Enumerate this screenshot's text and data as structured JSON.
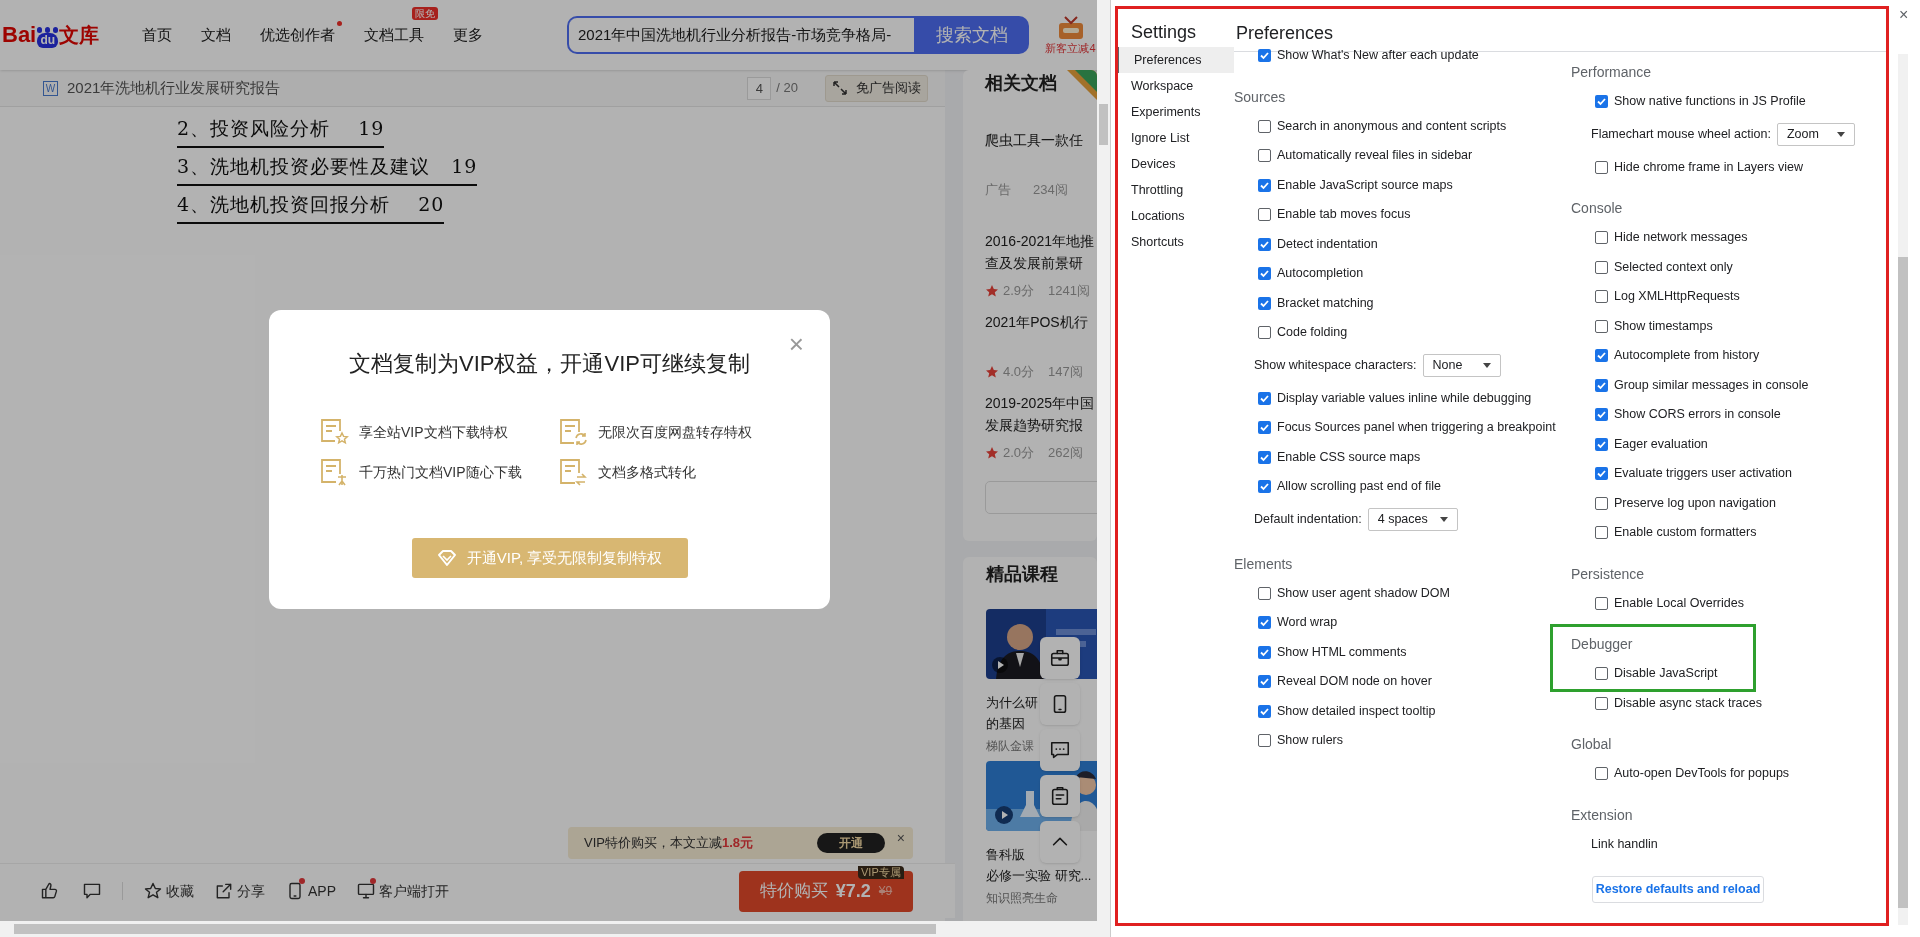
{
  "browser_page": {
    "header": {
      "logo": {
        "left": "Bai",
        "paw": "du",
        "right": "文库"
      },
      "nav": [
        {
          "label": "首页",
          "dot": false
        },
        {
          "label": "文档",
          "dot": false
        },
        {
          "label": "优选创作者",
          "dot": true
        },
        {
          "label": "文档工具",
          "dot": false,
          "badge": "限免"
        },
        {
          "label": "更多",
          "dot": false
        }
      ],
      "search": {
        "value": "2021年中国洗地机行业分析报告-市场竞争格局-",
        "button": "搜索文档"
      },
      "vip_promo": "新客立减4"
    },
    "doc_bar": {
      "file_type": "W",
      "title": "2021年洗地机行业发展研究报告",
      "page": "4",
      "total": "/ 20",
      "ad_free_button": "免广告阅读"
    },
    "toc": [
      "2、投资风险分析    19",
      "3、洗地机投资必要性及建议   19",
      "4、洗地机投资回报分析    20"
    ],
    "related": {
      "title": "相关文档",
      "items": [
        {
          "kind": "ad",
          "lines": [
            "爬虫工具一款任"
          ],
          "tag": "广告",
          "reads": "234阅"
        },
        {
          "kind": "doc",
          "lines": [
            "2016-2021年地推",
            "查及发展前景研"
          ],
          "score": "2.9分",
          "reads": "1241阅"
        },
        {
          "kind": "doc",
          "lines": [
            "2021年POS机行"
          ],
          "score": "4.0分",
          "reads": "147阅"
        },
        {
          "kind": "doc",
          "lines": [
            "2019-2025年中国",
            "发展趋势研究报"
          ],
          "score": "2.0分",
          "reads": "262阅"
        }
      ]
    },
    "courses": {
      "title": "精品课程",
      "items": [
        {
          "lines": [
            "为什么研",
            "的基因"
          ],
          "author": "梯队金课"
        },
        {
          "lines": [
            "鲁科版",
            "必修一实验 研究..."
          ],
          "author": "知识照亮生命"
        }
      ]
    },
    "floating_tools": [
      {
        "kind": "briefcase"
      },
      {
        "kind": "phone"
      },
      {
        "kind": "chat"
      },
      {
        "kind": "clipboard"
      },
      {
        "kind": "top"
      }
    ],
    "promo_bar": {
      "text": "VIP特价购买，本文立减",
      "amount": "1.8元",
      "button": "开通",
      "close": "×"
    },
    "bottom_bar": {
      "actions": [
        {
          "kind": "like",
          "dot": false
        },
        {
          "kind": "comment",
          "dot": false
        },
        {
          "kind": "star",
          "label": "收藏",
          "dot": false
        },
        {
          "kind": "share",
          "label": "分享",
          "dot": false
        },
        {
          "kind": "phone",
          "label": "APP",
          "dot": true
        },
        {
          "kind": "monitor",
          "label": "客户端打开",
          "dot": true
        }
      ],
      "buy": {
        "label": "特价购买",
        "price": "¥7.2",
        "old_price": "¥9",
        "badge": "VIP专属"
      }
    },
    "modal": {
      "title": "文档复制为VIP权益，开通VIP可继续复制",
      "close": "×",
      "features": [
        {
          "kind": "star",
          "label": "享全站VIP文档下载特权"
        },
        {
          "kind": "refresh",
          "label": "无限次百度网盘转存特权"
        },
        {
          "kind": "free",
          "label": "千万热门文档VIP随心下载"
        },
        {
          "kind": "convert",
          "label": "文档多格式转化"
        }
      ],
      "button": "开通VIP, 享受无限制复制特权"
    }
  },
  "devtools": {
    "outlined": true,
    "close": "×",
    "sidebar": {
      "title": "Settings",
      "items": [
        {
          "label": "Preferences",
          "selected": true
        },
        {
          "label": "Workspace",
          "selected": false
        },
        {
          "label": "Experiments",
          "selected": false
        },
        {
          "label": "Ignore List",
          "selected": false
        },
        {
          "label": "Devices",
          "selected": false
        },
        {
          "label": "Throttling",
          "selected": false
        },
        {
          "label": "Locations",
          "selected": false
        },
        {
          "label": "Shortcuts",
          "selected": false
        }
      ]
    },
    "panel_title": "Preferences",
    "columns": [
      [
        {
          "highlighted": false,
          "items": [
            {
              "kind": "checkbox",
              "label": "Show What's New after each update",
              "checked": true
            }
          ]
        },
        {
          "title": "Sources",
          "highlighted": false,
          "items": [
            {
              "kind": "checkbox",
              "label": "Search in anonymous and content scripts",
              "checked": false
            },
            {
              "kind": "checkbox",
              "label": "Automatically reveal files in sidebar",
              "checked": false
            },
            {
              "kind": "checkbox",
              "label": "Enable JavaScript source maps",
              "checked": true
            },
            {
              "kind": "checkbox",
              "label": "Enable tab moves focus",
              "checked": false
            },
            {
              "kind": "checkbox",
              "label": "Detect indentation",
              "checked": true
            },
            {
              "kind": "checkbox",
              "label": "Autocompletion",
              "checked": true
            },
            {
              "kind": "checkbox",
              "label": "Bracket matching",
              "checked": true
            },
            {
              "kind": "checkbox",
              "label": "Code folding",
              "checked": false
            },
            {
              "kind": "select",
              "label": "Show whitespace characters:",
              "value": "None"
            },
            {
              "kind": "checkbox",
              "label": "Display variable values inline while debugging",
              "checked": true
            },
            {
              "kind": "checkbox",
              "label": "Focus Sources panel when triggering a breakpoint",
              "checked": true
            },
            {
              "kind": "checkbox",
              "label": "Enable CSS source maps",
              "checked": true
            },
            {
              "kind": "checkbox",
              "label": "Allow scrolling past end of file",
              "checked": true
            },
            {
              "kind": "select",
              "label": "Default indentation:",
              "value": "4 spaces"
            }
          ]
        },
        {
          "title": "Elements",
          "highlighted": false,
          "items": [
            {
              "kind": "checkbox",
              "label": "Show user agent shadow DOM",
              "checked": false
            },
            {
              "kind": "checkbox",
              "label": "Word wrap",
              "checked": true
            },
            {
              "kind": "checkbox",
              "label": "Show HTML comments",
              "checked": true
            },
            {
              "kind": "checkbox",
              "label": "Reveal DOM node on hover",
              "checked": true
            },
            {
              "kind": "checkbox",
              "label": "Show detailed inspect tooltip",
              "checked": true
            },
            {
              "kind": "checkbox",
              "label": "Show rulers",
              "checked": false
            }
          ]
        }
      ],
      [
        {
          "title": "Performance",
          "highlighted": false,
          "items": [
            {
              "kind": "checkbox",
              "label": "Show native functions in JS Profile",
              "checked": true
            },
            {
              "kind": "select",
              "label": "Flamechart mouse wheel action:",
              "value": "Zoom"
            },
            {
              "kind": "checkbox",
              "label": "Hide chrome frame in Layers view",
              "checked": false
            }
          ]
        },
        {
          "title": "Console",
          "highlighted": false,
          "items": [
            {
              "kind": "checkbox",
              "label": "Hide network messages",
              "checked": false
            },
            {
              "kind": "checkbox",
              "label": "Selected context only",
              "checked": false
            },
            {
              "kind": "checkbox",
              "label": "Log XMLHttpRequests",
              "checked": false
            },
            {
              "kind": "checkbox",
              "label": "Show timestamps",
              "checked": false
            },
            {
              "kind": "checkbox",
              "label": "Autocomplete from history",
              "checked": true
            },
            {
              "kind": "checkbox",
              "label": "Group similar messages in console",
              "checked": true
            },
            {
              "kind": "checkbox",
              "label": "Show CORS errors in console",
              "checked": true
            },
            {
              "kind": "checkbox",
              "label": "Eager evaluation",
              "checked": true
            },
            {
              "kind": "checkbox",
              "label": "Evaluate triggers user activation",
              "checked": true
            },
            {
              "kind": "checkbox",
              "label": "Preserve log upon navigation",
              "checked": false
            },
            {
              "kind": "checkbox",
              "label": "Enable custom formatters",
              "checked": false
            }
          ]
        },
        {
          "title": "Persistence",
          "highlighted": false,
          "items": [
            {
              "kind": "checkbox",
              "label": "Enable Local Overrides",
              "checked": false
            }
          ]
        },
        {
          "title": "Debugger",
          "highlighted": true,
          "items": [
            {
              "kind": "checkbox",
              "label": "Disable JavaScript",
              "checked": false
            },
            {
              "kind": "checkbox",
              "label": "Disable async stack traces",
              "checked": false
            }
          ]
        },
        {
          "title": "Global",
          "highlighted": false,
          "items": [
            {
              "kind": "checkbox",
              "label": "Auto-open DevTools for popups",
              "checked": false
            }
          ]
        },
        {
          "title": "Extension",
          "highlighted": false,
          "items": [
            {
              "kind": "text",
              "label": "Link handlin"
            }
          ]
        }
      ]
    ],
    "restore_button": "Restore defaults and reload"
  }
}
